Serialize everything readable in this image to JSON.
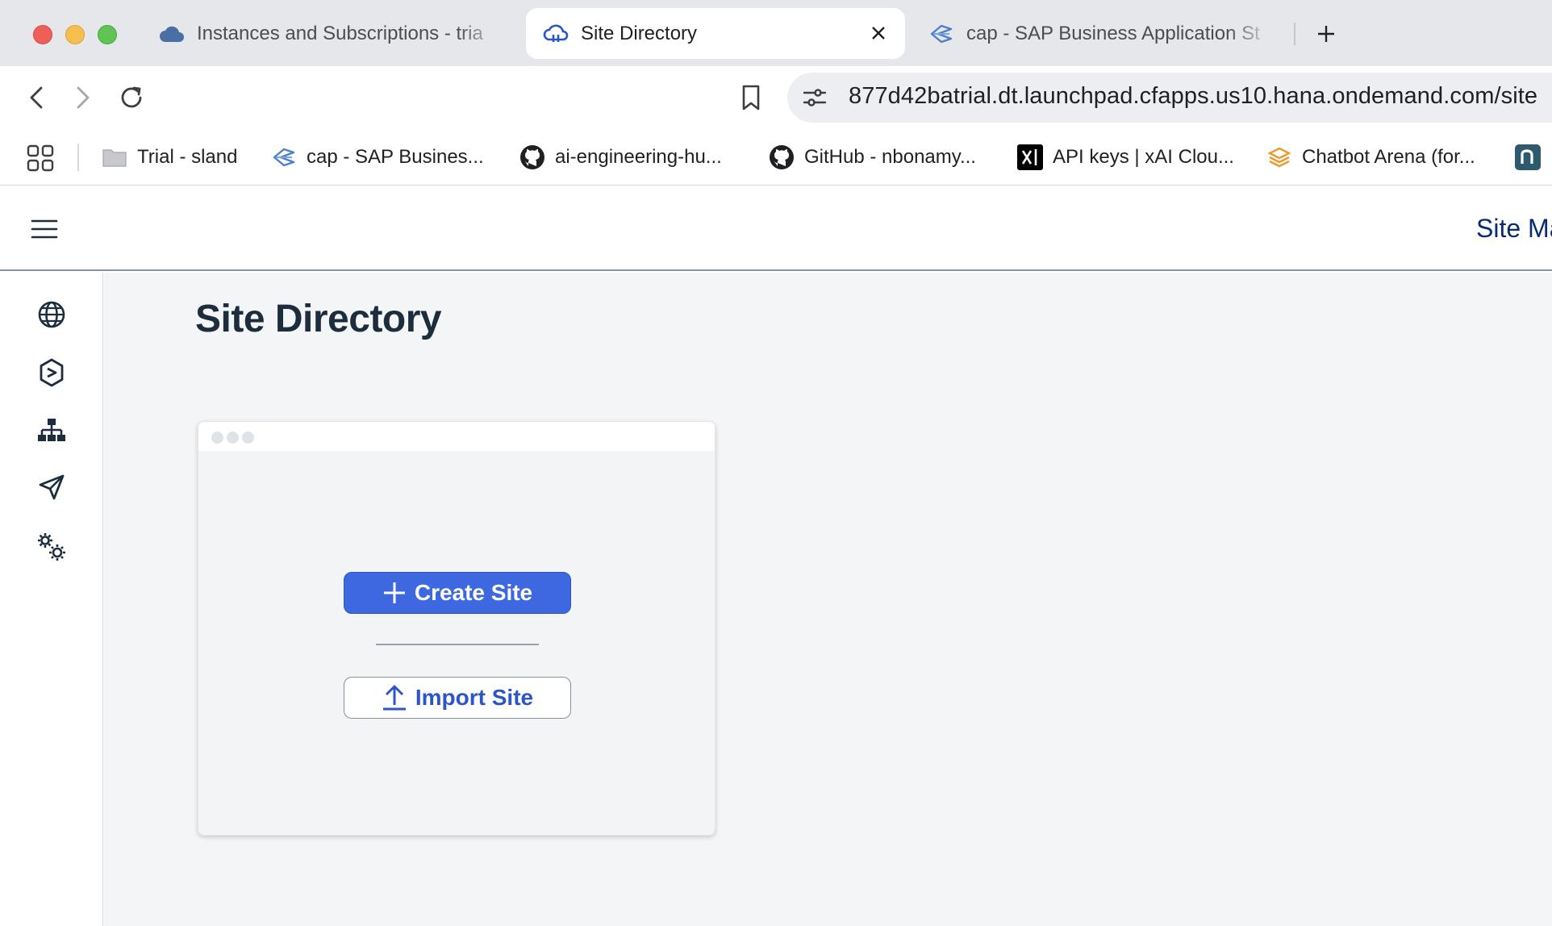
{
  "browser": {
    "tabs": [
      {
        "title": "Instances and Subscriptions - tria",
        "icon": "cloud-icon",
        "active": false
      },
      {
        "title": "Site Directory",
        "icon": "sap-cloud-icon",
        "active": true
      },
      {
        "title": "cap - SAP Business Application St",
        "icon": "sap-bas-icon",
        "active": false
      }
    ],
    "url": "877d42batrial.dt.launchpad.cfapps.us10.hana.ondemand.com/site",
    "bookmarks": [
      {
        "label": "Trial - sland",
        "icon": "folder-icon"
      },
      {
        "label": "cap - SAP Busines...",
        "icon": "sap-bas-icon"
      },
      {
        "label": "ai-engineering-hu...",
        "icon": "github-icon"
      },
      {
        "label": "GitHub - nbonamy...",
        "icon": "github-icon"
      },
      {
        "label": "API keys | xAI Clou...",
        "icon": "xai-icon"
      },
      {
        "label": "Chatbot Arena (for...",
        "icon": "chatbot-arena-icon"
      }
    ]
  },
  "app": {
    "shell_title": "Site Manager",
    "page_title": "Site Directory",
    "nav": [
      {
        "name": "globe-icon"
      },
      {
        "name": "content-manager-icon"
      },
      {
        "name": "hierarchy-icon"
      },
      {
        "name": "send-icon"
      },
      {
        "name": "settings-icon"
      }
    ],
    "card": {
      "create_label": "Create Site",
      "import_label": "Import Site"
    }
  },
  "colors": {
    "primary": "#3d68e0",
    "shell_title": "#0a2b6e",
    "content_bg": "#f4f5f7"
  }
}
